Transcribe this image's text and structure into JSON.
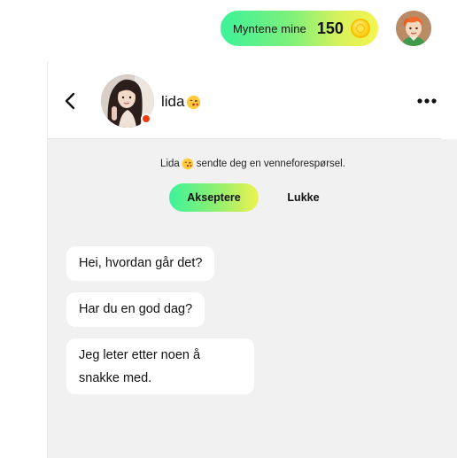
{
  "coins": {
    "label": "Myntene mine",
    "value": "150",
    "icon": "coin-icon"
  },
  "user": {
    "avatar_icon": "user-avatar"
  },
  "chat": {
    "contact_name": "lida",
    "contact_emoji": "kissing-face-emoji",
    "online_status_color": "#f23a0e",
    "friend_request": {
      "name": "Lida",
      "text": "sendte deg en venneforespørsel.",
      "accept_label": "Akseptere",
      "close_label": "Lukke"
    },
    "messages": [
      {
        "text": "Hei, hvordan går det?"
      },
      {
        "text": "Har du en god dag?"
      },
      {
        "text": "Jeg leter etter noen å snakke med."
      }
    ]
  },
  "colors": {
    "accent_gradient_start": "#3cf29a",
    "accent_gradient_end": "#f4f44e",
    "chat_background": "#f1f1f1",
    "bubble_background": "#ffffff"
  }
}
